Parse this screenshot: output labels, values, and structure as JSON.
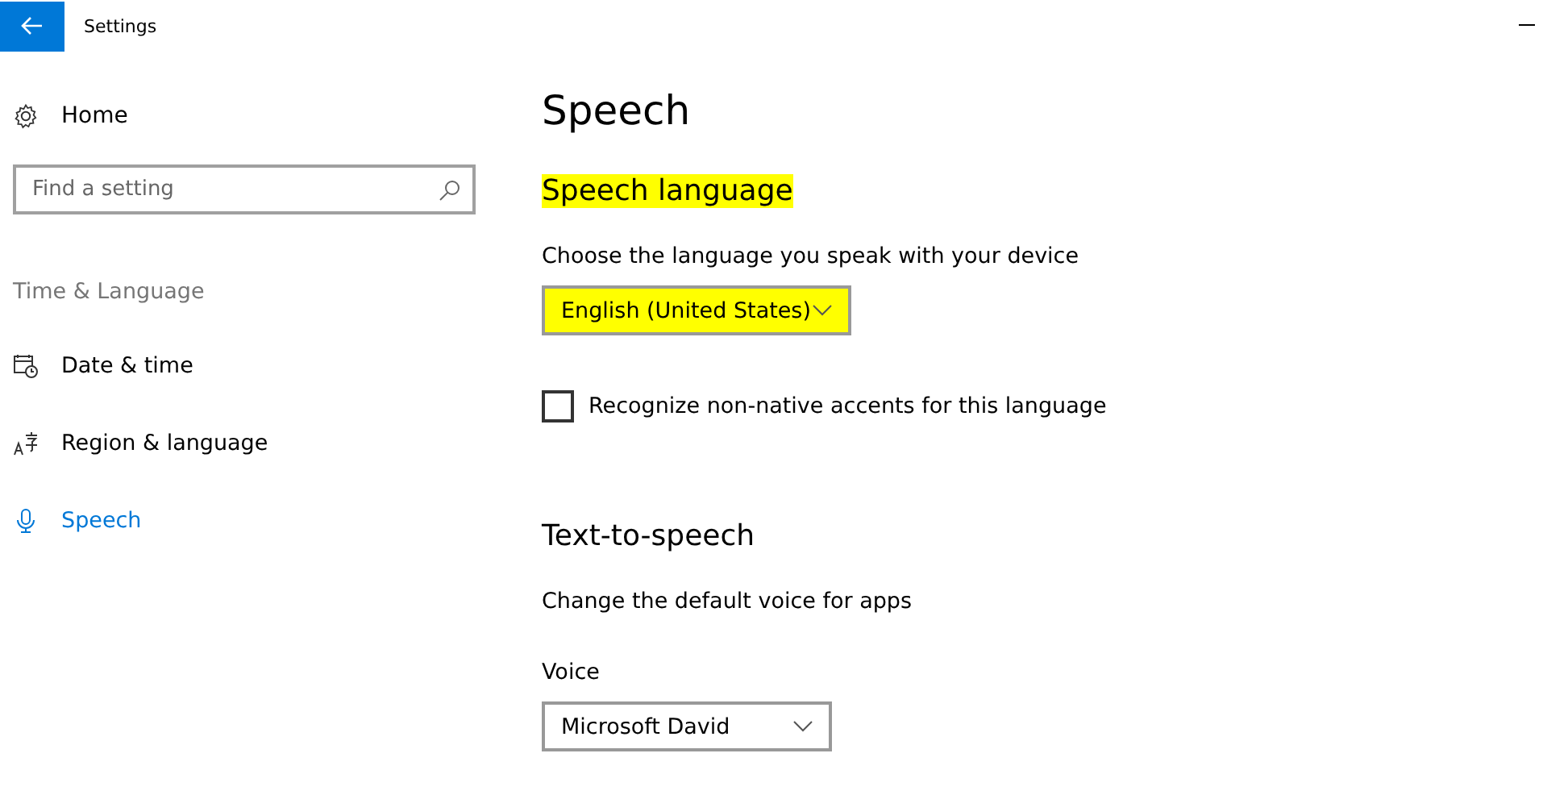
{
  "window": {
    "title": "Settings"
  },
  "sidebar": {
    "home": "Home",
    "search": {
      "placeholder": "Find a setting"
    },
    "group": "Time & Language",
    "items": [
      {
        "label": "Date & time",
        "kind": "calendar",
        "selected": false
      },
      {
        "label": "Region & language",
        "kind": "language",
        "selected": false
      },
      {
        "label": "Speech",
        "kind": "microphone",
        "selected": true
      }
    ]
  },
  "page": {
    "title": "Speech",
    "sections": [
      {
        "heading": "Speech language",
        "highlighted": true,
        "description": "Choose the language you speak with your device",
        "dropdown": {
          "value": "English (United States)",
          "highlighted": true
        },
        "checkbox": {
          "label": "Recognize non-native accents for this language",
          "checked": false
        }
      },
      {
        "heading": "Text-to-speech",
        "highlighted": false,
        "description": "Change the default voice for apps",
        "field_label": "Voice",
        "dropdown": {
          "value": "Microsoft David",
          "highlighted": false
        }
      }
    ]
  }
}
